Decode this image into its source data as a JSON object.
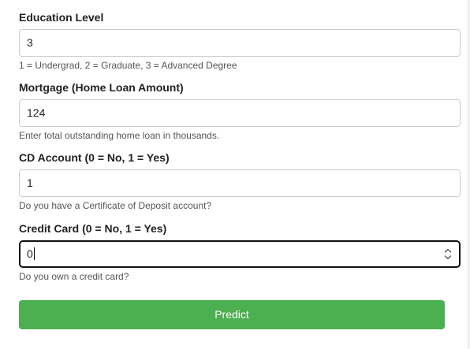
{
  "form": {
    "fields": [
      {
        "label": "Education Level",
        "value": "3",
        "help": "1 = Undergrad, 2 = Graduate, 3 = Advanced Degree"
      },
      {
        "label": "Mortgage (Home Loan Amount)",
        "value": "124",
        "help": "Enter total outstanding home loan in thousands."
      },
      {
        "label": "CD Account (0 = No, 1 = Yes)",
        "value": "1",
        "help": "Do you have a Certificate of Deposit account?"
      },
      {
        "label": "Credit Card (0 = No, 1 = Yes)",
        "value": "0",
        "help": "Do you own a credit card?"
      }
    ],
    "submit_label": "Predict"
  },
  "colors": {
    "submit_background": "#4caf50",
    "focused_border": "#111111",
    "input_border": "#cccccc"
  },
  "icons": {
    "stepper": "up-down-chevron-icon"
  }
}
